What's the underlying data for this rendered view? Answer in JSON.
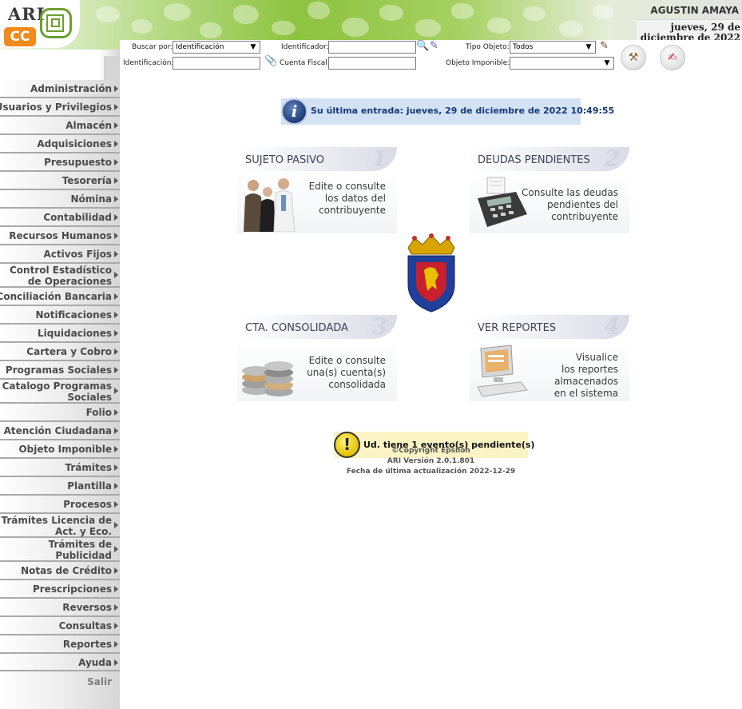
{
  "header": {
    "logo_text_ari": "ARI",
    "logo_text_cc": "CC",
    "user_name": "AGUSTIN AMAYA",
    "date_line_1": "jueves, 29 de",
    "date_line_2": "diciembre de 2022"
  },
  "search": {
    "buscar_por_label": "Buscar por:",
    "buscar_por_value": "Identificación",
    "identificador_label": "Identificador:",
    "identificador_value": "",
    "tipo_objeto_label": "Tipo Objeto:",
    "tipo_objeto_value": "Todos",
    "identificacion_label": "Identificación:",
    "identificacion_value": "",
    "cuenta_fiscal_label": "Cuenta Fiscal:",
    "cuenta_fiscal_value": "",
    "objeto_imponible_label": "Objeto Imponible:",
    "objeto_imponible_value": ""
  },
  "sidebar": {
    "items": [
      {
        "label": "Administración"
      },
      {
        "label": "Usuarios y Privilegios"
      },
      {
        "label": "Almacén"
      },
      {
        "label": "Adquisiciones"
      },
      {
        "label": "Presupuesto"
      },
      {
        "label": "Tesorería"
      },
      {
        "label": "Nómina"
      },
      {
        "label": "Contabilidad"
      },
      {
        "label": "Recursos Humanos"
      },
      {
        "label": "Activos Fijos"
      },
      {
        "label": "Control Estadístico\nde Operaciones"
      },
      {
        "label": "Conciliación Bancaria"
      },
      {
        "label": "Notificaciones"
      },
      {
        "label": "Liquidaciones"
      },
      {
        "label": "Cartera y Cobro"
      },
      {
        "label": "Programas Sociales"
      },
      {
        "label": "Catalogo Programas\nSociales"
      },
      {
        "label": "Folio"
      },
      {
        "label": "Atención Ciudadana"
      },
      {
        "label": "Objeto Imponible"
      },
      {
        "label": "Trámites"
      },
      {
        "label": "Plantilla"
      },
      {
        "label": "Procesos"
      },
      {
        "label": "Trámites Licencia de\nAct. y Eco."
      },
      {
        "label": "Trámites de\nPublicidad"
      },
      {
        "label": "Notas de Crédito"
      },
      {
        "label": "Prescripciones"
      },
      {
        "label": "Reversos"
      },
      {
        "label": "Consultas"
      },
      {
        "label": "Reportes"
      },
      {
        "label": "Ayuda"
      }
    ],
    "salir": "Salir"
  },
  "main": {
    "info_banner": "Su última entrada: jueves, 29 de diciembre de 2022 10:49:55",
    "cards": [
      {
        "title": "SUJETO PASIVO",
        "number": "1",
        "description": "Edite o consulte\nlos datos del\ncontribuyente"
      },
      {
        "title": "DEUDAS PENDIENTES",
        "number": "2",
        "description": "Consulte las deudas\npendientes del\ncontribuyente"
      },
      {
        "title": "CTA. CONSOLIDADA",
        "number": "3",
        "description": "Edite o consulte\nuna(s) cuenta(s)\nconsolidada"
      },
      {
        "title": "VER REPORTES",
        "number": "4",
        "description": "Visualice\nlos reportes\nalmacenados\nen el sistema"
      }
    ],
    "event_banner": "Ud. tiene 1 evento(s) pendiente(s)",
    "copyright": "©Copyright Epsilon",
    "version": "ARI Versión 2.0.1.801",
    "last_update": "Fecha de última actualización 2022-12-29"
  },
  "colors": {
    "header_green": "#8dc33f",
    "logo_orange": "#f08a1c",
    "info_banner_bg": "#d4e3f3",
    "info_text": "#15387b",
    "event_banner_bg": "#fbf3c4",
    "sidebar_text": "#4a4a4a"
  },
  "icons": {
    "identificador_search": "magnifier-icon",
    "identificador_clear": "eraser-icon",
    "tipo_objeto_edit": "edit-icon",
    "identificacion_attach": "paperclip-icon",
    "tool_button_1": "tools-icon",
    "tool_button_2": "form-edit-icon",
    "info": "info-icon",
    "warning": "warning-icon"
  }
}
